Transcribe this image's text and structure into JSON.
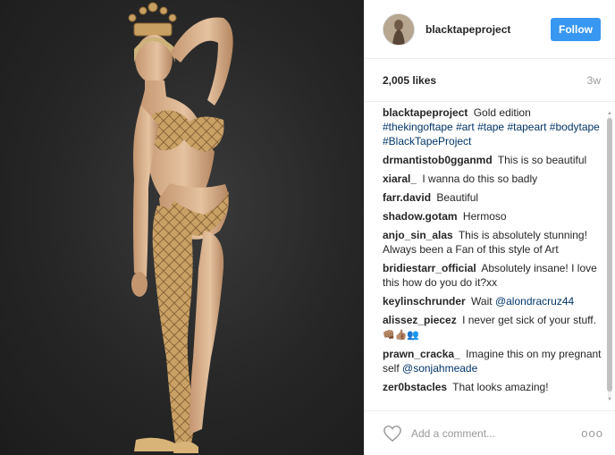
{
  "post": {
    "username": "blacktapeproject",
    "follow_label": "Follow",
    "likes": "2,005 likes",
    "age": "3w",
    "add_comment_placeholder": "Add a comment...",
    "more_symbol": "ooo"
  },
  "caption": {
    "author": "blacktapeproject",
    "text": "Gold edition",
    "tags": "#thekingoftape #art #tape #tapeart #bodytape #BlackTapeProject"
  },
  "comments": [
    {
      "author": "drmantistob0gganmd",
      "text": "This is so beautiful"
    },
    {
      "author": "xiaral_",
      "text": "I wanna do this so badly"
    },
    {
      "author": "farr.david",
      "text": "Beautiful"
    },
    {
      "author": "shadow.gotam",
      "text": "Hermoso"
    },
    {
      "author": "anjo_sin_alas",
      "text": "This is absolutely stunning! Always been a Fan of this style of Art"
    },
    {
      "author": "bridiestarr_official",
      "text": "Absolutely insane! I love this how do you do it?xx"
    },
    {
      "author": "keylinschrunder",
      "text": "Wait",
      "mention": "@alondracruz44"
    },
    {
      "author": "alissez_piecez",
      "text": "I never get sick of your stuff.",
      "emoji": "👊🏽👍🏽👥"
    },
    {
      "author": "prawn_cracka_",
      "text": "Imagine this on my pregnant self",
      "mention": "@sonjahmeade"
    },
    {
      "author": "zer0bstacles",
      "text": "That looks amazing!"
    }
  ],
  "colors": {
    "accent": "#3897f0",
    "hashtag": "#003569",
    "photo_background": "#262626",
    "gold": "#c9a063"
  },
  "icons": {
    "like": "heart-outline-icon",
    "more": "more-options-icon"
  }
}
